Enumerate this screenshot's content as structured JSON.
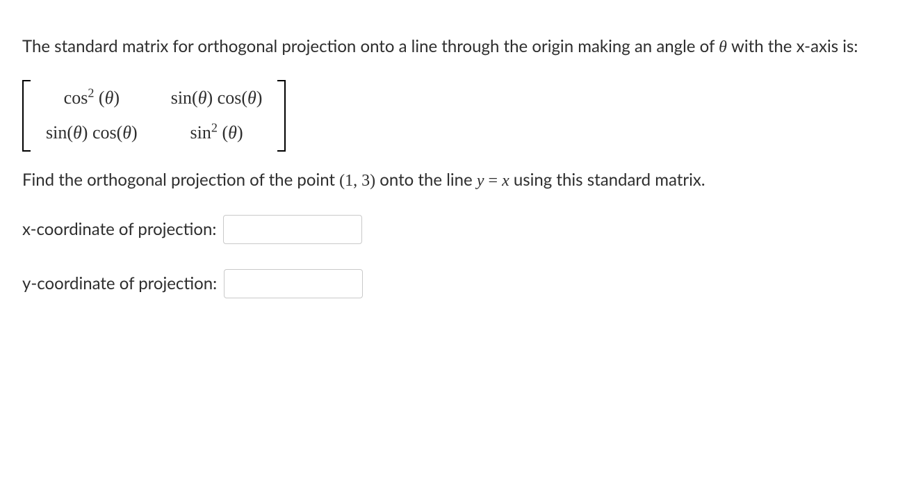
{
  "intro": {
    "before_theta": "The standard matrix for orthogonal projection onto a line through the origin making an angle of ",
    "theta": "θ",
    "after_theta": " with the x-axis is:"
  },
  "matrix": {
    "a11": "cos² (θ)",
    "a12": "sin(θ) cos(θ)",
    "a21": "sin(θ) cos(θ)",
    "a22": "sin² (θ)"
  },
  "question": {
    "before_point": "Find the orthogonal projection of the point ",
    "point": "(1, 3)",
    "between": " onto the line ",
    "eqn_y": "y",
    "eqn_eq": " = ",
    "eqn_x": "x",
    "after": " using this standard matrix."
  },
  "inputs": {
    "x_label": "x-coordinate of projection:",
    "y_label": "y-coordinate of projection:",
    "x_value": "",
    "y_value": ""
  }
}
